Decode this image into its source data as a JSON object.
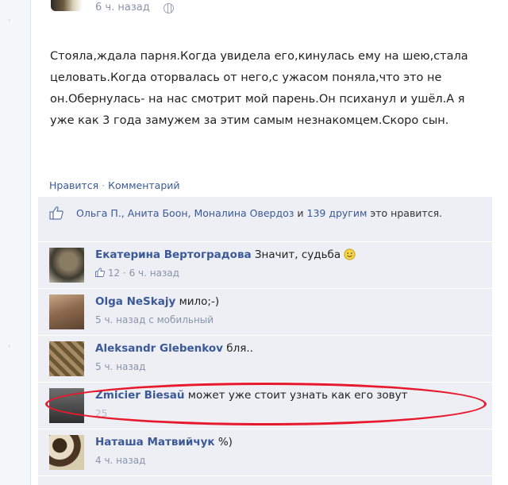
{
  "post": {
    "time": "6 ч. назад",
    "text": "Стояла,ждала парня.Когда увидела его,кинулась ему на шею,стала целовать.Когда оторвалась от него,с ужасом поняла,что это не он.Обернулась- на нас смотрит мой парень.Он психанул и ушёл.А я уже как 3 года замужем за этим самым незнакомцем.Скоро сын."
  },
  "actions": {
    "like": "Нравится",
    "separator": "·",
    "comment": "Комментарий"
  },
  "likes": {
    "names": "Ольга П., Анита Боон, Моналина Овердоз",
    "joiner": " и ",
    "others": "139 другим",
    "suffix": " это нравится."
  },
  "comments": [
    {
      "author": "Екатерина Вертоградова",
      "text": " Значит, судьба",
      "likes": "12",
      "meta": "6 ч. назад"
    },
    {
      "author": "Olga NeSkajy",
      "text": " мило;-)",
      "meta": "5 ч. назад с мобильный"
    },
    {
      "author": "Aleksandr Glebenkov",
      "text": " бля..",
      "meta": "5 ч. назад"
    },
    {
      "author": "Zmicier Biesaŭ",
      "text": " может уже стоит узнать как его зовут",
      "meta": "25"
    },
    {
      "author": "Наташа Матвийчук",
      "text": " %)",
      "meta": "4 ч. назад"
    }
  ],
  "meta_separator": " · ",
  "colors": {
    "link": "#3b5998",
    "panel": "#edeff4",
    "highlight": "#e8192c"
  }
}
